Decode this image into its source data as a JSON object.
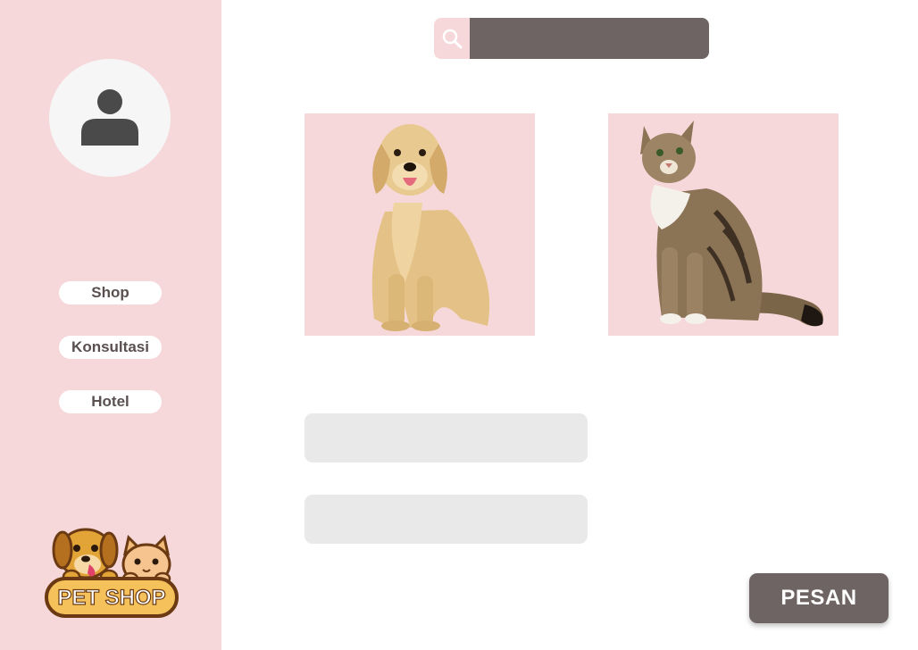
{
  "sidebar": {
    "avatar_icon": "user-icon",
    "nav": [
      {
        "label": "Shop"
      },
      {
        "label": "Konsultasi"
      },
      {
        "label": "Hotel"
      }
    ],
    "logo": {
      "text": "PET SHOP",
      "icon": "dog-and-cat-logo"
    }
  },
  "search": {
    "icon": "search-icon",
    "value": "",
    "placeholder": ""
  },
  "cards": [
    {
      "image": "golden-retriever-dog"
    },
    {
      "image": "tabby-cat"
    }
  ],
  "form": {
    "field1_value": "",
    "field2_value": ""
  },
  "order_button": {
    "label": "PESAN"
  },
  "colors": {
    "sidebar_bg": "#f6d8db",
    "card_bg": "#f6d8db",
    "accent_dark": "#6e6463",
    "field_bg": "#e9e9e9",
    "nav_text": "#5a5050"
  }
}
